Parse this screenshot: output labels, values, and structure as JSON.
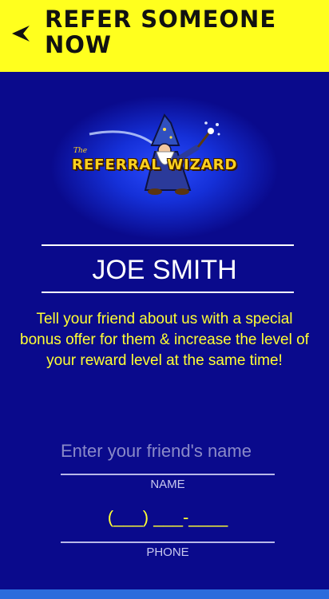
{
  "header": {
    "title": "REFER SOMEONE NOW",
    "back_icon": "back-arrow-icon",
    "background_color": "#ffff1e"
  },
  "logo": {
    "the_text": "The",
    "brand_text": "REFERRAL WIZARD",
    "icon": "wizard-icon"
  },
  "user": {
    "name": "JOE SMITH"
  },
  "description": "Tell your friend about us with a special bonus offer for them & increase the level of your reward level at the same time!",
  "form": {
    "name_placeholder": "Enter your friend's name",
    "name_label": "NAME",
    "phone_placeholder": "(___) ___-____",
    "phone_label": "PHONE"
  },
  "colors": {
    "background": "#0a0a8c",
    "accent_yellow": "#ffff33",
    "bottom_strip": "#2a6cdc"
  }
}
